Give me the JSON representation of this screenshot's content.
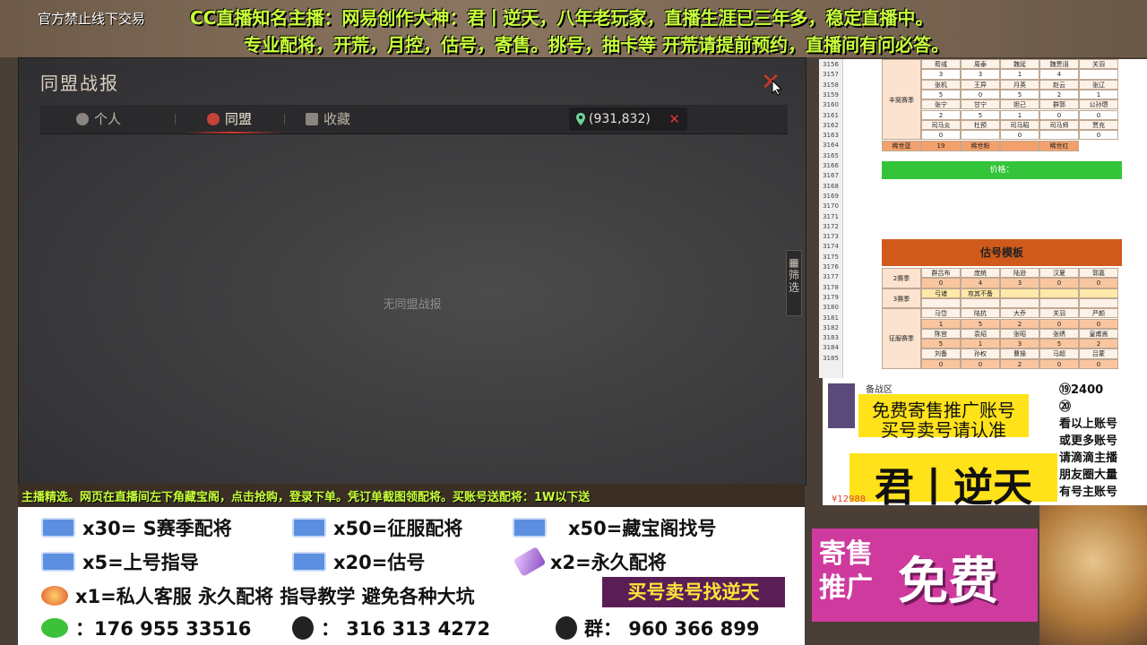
{
  "top_banner": {
    "notice": "官方禁止线下交易",
    "line1": "CC直播知名主播：网易创作大神：君丨逆天，八年老玩家，直播生涯已三年多，稳定直播中。",
    "line2": "专业配将，开荒，月控，估号，寄售。挑号，抽卡等  开荒请提前预约，直播间有问必答。"
  },
  "game_window": {
    "title": "同盟战报",
    "tabs": [
      {
        "label": "个人",
        "icon": "person-icon"
      },
      {
        "label": "同盟",
        "icon": "alliance-icon",
        "active": true
      },
      {
        "label": "收藏",
        "icon": "bookmark-icon"
      }
    ],
    "coordinates": "(931,832)",
    "empty_message": "无同盟战报",
    "filter_label": "筛选"
  },
  "spreadsheet": {
    "row_numbers": [
      "3156",
      "3157",
      "3158",
      "3159",
      "3160",
      "3161",
      "3162",
      "3163",
      "3164",
      "3165",
      "3166",
      "3167",
      "3168",
      "3169",
      "3170",
      "3171",
      "3172",
      "3173",
      "3174",
      "3175",
      "3176",
      "3177",
      "3178",
      "3179",
      "3180",
      "3181",
      "3182",
      "3183",
      "3184",
      "3185"
    ],
    "season_label": "丰窝赛季",
    "heroes_top": [
      [
        "荀彧",
        "周泰",
        "魏延",
        "魏贾诩",
        "关羽"
      ],
      [
        "3",
        "3",
        "1",
        "4",
        ""
      ],
      [
        "张机",
        "王异",
        "月英",
        "赵云",
        "张辽"
      ],
      [
        "5",
        "0",
        "5",
        "2",
        "1"
      ],
      [
        "张宁",
        "甘宁",
        "妲己",
        "群郭",
        "公孙瓒"
      ],
      [
        "2",
        "5",
        "1",
        "0",
        "0"
      ],
      [
        "司马炎",
        "杜预",
        "司马昭",
        "司马师",
        "贾充"
      ],
      [
        "0",
        "",
        "0",
        "",
        "0"
      ]
    ],
    "rare_row": [
      "稀世蓝",
      "19",
      "稀世粉",
      "",
      "稀世红"
    ],
    "price_label": "价格：",
    "template_title": "估号模板",
    "season2_label": "2赛季",
    "season2_heroes": [
      "群吕布",
      "庞统",
      "陆逊",
      "汉夏",
      "郭嘉"
    ],
    "season2_values": [
      "0",
      "4",
      "3",
      "0",
      "0"
    ],
    "season3_label": "3赛季",
    "season3_heroes": [
      "弓诸",
      "攻其不备"
    ],
    "conquest_label": "征服赛季",
    "conquest_heroes_1": [
      "马岱",
      "陆抗",
      "大乔",
      "关羽",
      "严颜"
    ],
    "conquest_values_1": [
      "1",
      "5",
      "2",
      "0",
      "0"
    ],
    "conquest_heroes_2": [
      "陈宫",
      "袁绍",
      "张昭",
      "张绣",
      "皇甫嵩"
    ],
    "conquest_values_2": [
      "5",
      "1",
      "3",
      "5",
      "2"
    ],
    "conquest_heroes_3": [
      "刘备",
      "孙权",
      "曹操",
      "马超",
      "吕蒙"
    ],
    "conquest_values_3": [
      "0",
      "0",
      "2",
      "0",
      "0"
    ]
  },
  "promo_card": {
    "zone": "备战区",
    "line1": "免费寄售推广账号",
    "line2": "买号卖号请认准",
    "name": "君丨逆天",
    "price": "¥12988",
    "right_lines": [
      "⑲2400",
      "⑳",
      "看以上账号",
      "或更多账号",
      "请滴滴主播",
      "朋友圈大量",
      "有号主账号"
    ]
  },
  "consign_banner": {
    "small": "寄售推广",
    "big": "免费"
  },
  "ticker": "主播精选。网页在直播间左下角藏宝阁，点击抢购，登录下单。凭订单截图领配将。买账号送配将：1W以下送",
  "ad_panel": {
    "items": [
      {
        "text": "x30= S赛季配将",
        "icon": "ticket-icon"
      },
      {
        "text": "x50=征服配将",
        "icon": "ticket-icon"
      },
      {
        "text": "x50=藏宝阁找号",
        "icon": "ticket-icon"
      },
      {
        "text": "x5=上号指导",
        "icon": "ticket-icon"
      },
      {
        "text": "x20=估号",
        "icon": "ticket-icon"
      },
      {
        "text": "x2=永久配将",
        "icon": "crystal-icon"
      },
      {
        "text": "x1=私人客服 永久配将 指导教学 避免各种大坑",
        "icon": "gem-icon"
      }
    ],
    "buy_sell": "买号卖号找逆天",
    "wechat": "：176 955 33516",
    "qq": "：  316 313 4272",
    "group": "群： 960 366 899"
  },
  "colors": {
    "banner_text": "#c8ff3a",
    "promo_yellow": "#ffe21a",
    "consign_pink": "#cf3a9e",
    "tab_active": "#c64236"
  }
}
